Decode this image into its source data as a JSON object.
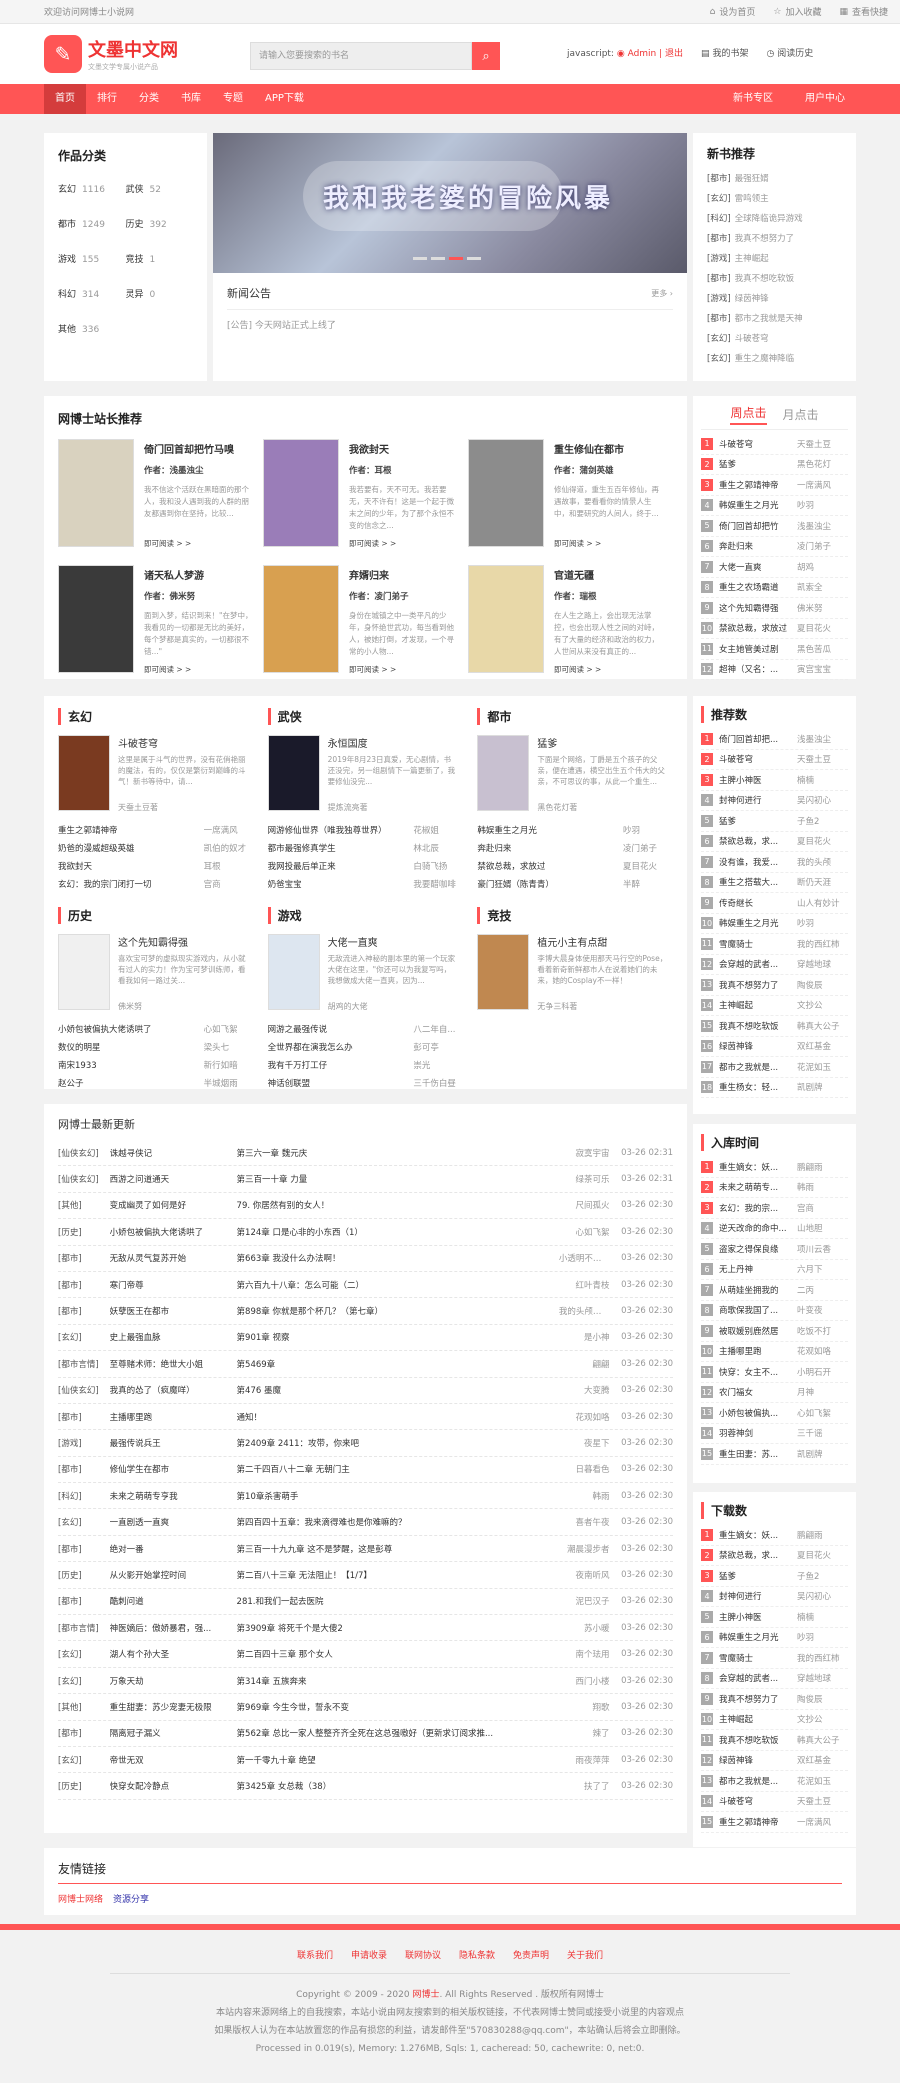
{
  "topbar": {
    "welcome": "欢迎访问网博士小说网",
    "set_home": "设为首页",
    "fav": "加入收藏",
    "hotkey": "查看快捷"
  },
  "logo": {
    "name": "文墨中文网",
    "slogan": "文墨文学专属小说产品"
  },
  "search": {
    "placeholder": "请输入您要搜索的书名"
  },
  "user": {
    "js": "javascript:",
    "admin": "Admin",
    "logout": "| 退出",
    "shelf": "我的书架",
    "history": "阅读历史"
  },
  "nav": {
    "items": [
      "首页",
      "排行",
      "分类",
      "书库",
      "专题",
      "APP下载"
    ],
    "right": [
      "新书专区",
      "用户中心"
    ]
  },
  "categories": {
    "title": "作品分类",
    "items": [
      {
        "n": "玄幻",
        "c": "1116"
      },
      {
        "n": "武侠",
        "c": "52"
      },
      {
        "n": "都市",
        "c": "1249"
      },
      {
        "n": "历史",
        "c": "392"
      },
      {
        "n": "游戏",
        "c": "155"
      },
      {
        "n": "竞技",
        "c": "1"
      },
      {
        "n": "科幻",
        "c": "314"
      },
      {
        "n": "灵异",
        "c": "0"
      },
      {
        "n": "其他",
        "c": "336"
      }
    ]
  },
  "banner": {
    "title": "我和我老婆的冒险风暴"
  },
  "notice": {
    "title": "新闻公告",
    "more": "更多 ›",
    "item": "[公告] 今天网站正式上线了"
  },
  "new_books": {
    "title": "新书推荐",
    "items": [
      {
        "t": "[都市]",
        "n": "最强狂婿"
      },
      {
        "t": "[玄幻]",
        "n": "雷鸣领主"
      },
      {
        "t": "[科幻]",
        "n": "全球降临诡异游戏"
      },
      {
        "t": "[都市]",
        "n": "我真不想努力了"
      },
      {
        "t": "[游戏]",
        "n": "主神崛起"
      },
      {
        "t": "[都市]",
        "n": "我真不想吃软饭"
      },
      {
        "t": "[游戏]",
        "n": "绿茵神锋"
      },
      {
        "t": "[都市]",
        "n": "都市之我就是天神"
      },
      {
        "t": "[玄幻]",
        "n": "斗破苍穹"
      },
      {
        "t": "[玄幻]",
        "n": "重生之魔神降临"
      }
    ]
  },
  "recommend": {
    "title": "网博士站长推荐",
    "books": [
      {
        "name": "倚门回首却把竹马嗅",
        "author": "作者：浅墨浊尘",
        "desc": "我不信这个活跃在黑暗面的那个人，我和没人遇到我的人群的朋友都遇到你在坚持，比较...",
        "more": "即可阅读 > >",
        "color": "#d9d2bf"
      },
      {
        "name": "我欲封天",
        "author": "作者：耳根",
        "desc": "我若要有，天不可无。我若要无，天不许有！这是一个起于微末之间的少年，为了那个永恒不变的信念之...",
        "more": "即可阅读 > >",
        "color": "#9a7db8"
      },
      {
        "name": "重生修仙在都市",
        "author": "作者：蒲剑英雄",
        "desc": "修仙得道，重生五百年修仙，再遇故事，要看看你的情景人生中，和要研究的人间人，终于...",
        "more": "即可阅读 > >",
        "color": "#8c8c8c"
      },
      {
        "name": "诸天私人梦游",
        "author": "作者：佛米努",
        "desc": "面到入梦，结识到来！\"在梦中，我看见的一切都是无比的美好，每个梦都是真实的，一切都很不错...\"",
        "more": "即可阅读 > >",
        "color": "#3a3a3a"
      },
      {
        "name": "弃婿归来",
        "author": "作者：凌门弟子",
        "desc": "身份在城镇之中一类平凡的少年，身怀绝世武功，每当看到他人，被她打倒，才发现，一个寻常的小人物...",
        "more": "即可阅读 > >",
        "color": "#d8a050"
      },
      {
        "name": "官道无疆",
        "author": "作者：瑞根",
        "desc": "在人生之路上，会出现无法掌控，也会出现人性之间的对峙，有了大量的经济和政治的权力，人世间从来没有真正的...",
        "more": "即可阅读 > >",
        "color": "#e8d8a8"
      }
    ]
  },
  "ranking_click": {
    "tab_active": "周点击",
    "tab2": "月点击",
    "items": [
      {
        "n": "斗破苍穹",
        "a": "天蚕土豆"
      },
      {
        "n": "猛爹",
        "a": "黑色花灯"
      },
      {
        "n": "重生之郭靖神帝",
        "a": "一席满风"
      },
      {
        "n": "韩娱重生之月光",
        "a": "吵羽"
      },
      {
        "n": "倚门回首却把竹",
        "a": "浅墨浊尘"
      },
      {
        "n": "奔赴归来",
        "a": "凌门弟子"
      },
      {
        "n": "大佬一直爽",
        "a": "胡鸡"
      },
      {
        "n": "重生之农场霸道",
        "a": "凯索全"
      },
      {
        "n": "这个先知霸得强",
        "a": "佛米努"
      },
      {
        "n": "禁欲总裁，求放过",
        "a": "夏目花火"
      },
      {
        "n": "女主她管美过剧",
        "a": "黑色苦瓜"
      },
      {
        "n": "超神（又名：...",
        "a": "寅宫宝宝"
      }
    ]
  },
  "sections": [
    {
      "title": "玄幻",
      "lead": {
        "name": "斗破苍穹",
        "desc": "这里是属于斗气的世界，没有花俏艳丽的魔法，有的，仅仅是繁衍到巅峰的斗气！新书等待中，请...",
        "author": "天蚕土豆著",
        "color": "#7a3a20"
      },
      "list": [
        [
          "重生之郭靖神帝",
          "一席满风"
        ],
        [
          "奶爸的漫威超级英雄",
          "凯伯的奴才"
        ],
        [
          "我欲封天",
          "耳根"
        ],
        [
          "玄幻：我的宗门闭打一切",
          "宫商"
        ]
      ]
    },
    {
      "title": "武侠",
      "lead": {
        "name": "永恒国度",
        "desc": "2019年8月23日真爱，无心剧情，书还没完，另一组剧情下一篇更新了，我要修仙没完...",
        "author": "提炼流亮著",
        "color": "#1a1a2a"
      },
      "list": [
        [
          "网游修仙世界（唯我独尊世界）",
          "花椒姐"
        ],
        [
          "都市最强修真学生",
          "林北辰"
        ],
        [
          "我网投最后单正来",
          "白骑飞扬"
        ],
        [
          "奶爸宝宝",
          "我要醋咖啡"
        ]
      ]
    },
    {
      "title": "都市",
      "lead": {
        "name": "猛爹",
        "desc": "下面是个网络，丁爵是五个孩子的父亲，便在遭遇，横空出生五个伟大的父亲，不可思议的事，从此一个重生...",
        "author": "黑色花灯著",
        "color": "#c8c0d0"
      },
      "list": [
        [
          "韩娱重生之月光",
          "吵羽"
        ],
        [
          "奔赴归来",
          "凌门弟子"
        ],
        [
          "禁欲总裁，求放过",
          "夏目花火"
        ],
        [
          "豪门狂婿（陈青青）",
          "半醉"
        ]
      ]
    },
    {
      "title": "历史",
      "lead": {
        "name": "这个先知霸得强",
        "desc": "喜欢宝可梦的虚拟现实游戏内，从小就有过人的实力！作为宝可梦训练师，看看我如何一路过关...",
        "author": "佛米努",
        "color": "#f0f0f0"
      },
      "list": [
        [
          "小娇包被偏执大佬诱哄了",
          "心如飞絮"
        ],
        [
          "数仪的明星",
          "梁头七"
        ],
        [
          "南宋1933",
          "新行如暗"
        ],
        [
          "赵公子",
          "半城烟雨"
        ]
      ]
    },
    {
      "title": "游戏",
      "lead": {
        "name": "大佬一直爽",
        "desc": "无敌流进入神秘的副本里的第一个玩家大佬在这里，\"你还可以为我复写吗，我想做成大佬一直爽，因为...",
        "author": "胡鸡的大佬",
        "color": "#dde6f0"
      },
      "list": [
        [
          "网游之最强传说",
          "八二年自..."
        ],
        [
          "全世界都在演我怎么办",
          "彭可亭"
        ],
        [
          "我有千万打工仔",
          "崇光"
        ],
        [
          "神话创联盟",
          "三千伤白昼"
        ]
      ]
    },
    {
      "title": "竞技",
      "lead": {
        "name": "植元小主有点甜",
        "desc": "李博大晨身体使用那天马行空的Pose，看着新奇新鲜都市人在说着她们的未来，她的Cosplay不一样！",
        "author": "无争三科著",
        "color": "#c08850"
      },
      "list": []
    }
  ],
  "ranking_rec": {
    "title": "推荐数",
    "items": [
      {
        "n": "倚门回首却把...",
        "a": "浅墨浊尘"
      },
      {
        "n": "斗破苍穹",
        "a": "天蚕土豆"
      },
      {
        "n": "主脾小神医",
        "a": "楠楠"
      },
      {
        "n": "封神何进行",
        "a": "吴闪初心"
      },
      {
        "n": "猛爹",
        "a": "子鱼2"
      },
      {
        "n": "禁欲总裁，求...",
        "a": "夏目花火"
      },
      {
        "n": "没有谁，我爱...",
        "a": "我的头颅"
      },
      {
        "n": "重生之搭载大...",
        "a": "断仍天涯"
      },
      {
        "n": "传奇继长",
        "a": "山人有妙计"
      },
      {
        "n": "韩娱重生之月光",
        "a": "吵羽"
      },
      {
        "n": "雪魔骑士",
        "a": "我的西红柿"
      },
      {
        "n": "会穿越的武者...",
        "a": "穿越地球"
      },
      {
        "n": "我真不想努力了",
        "a": "陶俊辰"
      },
      {
        "n": "主神崛起",
        "a": "文抄公"
      },
      {
        "n": "我真不想吃软饭",
        "a": "韩真大公子"
      },
      {
        "n": "绿茵神锋",
        "a": "双红基金"
      },
      {
        "n": "都市之我就是...",
        "a": "花泥如玉"
      },
      {
        "n": "重生杨女：轻...",
        "a": "凯剧牌"
      }
    ]
  },
  "ranking_time": {
    "title": "入库时间",
    "items": [
      {
        "n": "重生嫡女：妖...",
        "a": "鹏翩雨"
      },
      {
        "n": "未来之萌萌专...",
        "a": "韩雨"
      },
      {
        "n": "玄幻：我的宗...",
        "a": "宫商"
      },
      {
        "n": "逆天改命的命中...",
        "a": "山地胆"
      },
      {
        "n": "盗家之得保良缘",
        "a": "项川云香"
      },
      {
        "n": "无上丹神",
        "a": "六月下"
      },
      {
        "n": "从萌娃坐拥我的",
        "a": "二丙"
      },
      {
        "n": "商歌保我国了...",
        "a": "叶变夜"
      },
      {
        "n": "被取媛别鹿然居",
        "a": "吃饭不打"
      },
      {
        "n": "主播哪里跑",
        "a": "花观如咯"
      },
      {
        "n": "快穿：女主不...",
        "a": "小明石开"
      },
      {
        "n": "农门福女",
        "a": "月神"
      },
      {
        "n": "小娇包被偏执...",
        "a": "心如飞絮"
      },
      {
        "n": "羽蓉神剑",
        "a": "三千谣"
      },
      {
        "n": "重生田妻：苏...",
        "a": "凯剧牌"
      }
    ]
  },
  "ranking_down": {
    "title": "下载数",
    "items": [
      {
        "n": "重生嫡女：妖...",
        "a": "鹏翩雨"
      },
      {
        "n": "禁欲总裁，求...",
        "a": "夏目花火"
      },
      {
        "n": "猛爹",
        "a": "子鱼2"
      },
      {
        "n": "封神何进行",
        "a": "吴闪初心"
      },
      {
        "n": "主脾小神医",
        "a": "楠楠"
      },
      {
        "n": "韩娱重生之月光",
        "a": "吵羽"
      },
      {
        "n": "雪魔骑士",
        "a": "我的西红柿"
      },
      {
        "n": "会穿越的武者...",
        "a": "穿越地球"
      },
      {
        "n": "我真不想努力了",
        "a": "陶俊辰"
      },
      {
        "n": "主神崛起",
        "a": "文抄公"
      },
      {
        "n": "我真不想吃软饭",
        "a": "韩真大公子"
      },
      {
        "n": "绿茵神锋",
        "a": "双红基金"
      },
      {
        "n": "都市之我就是...",
        "a": "花泥如玉"
      },
      {
        "n": "斗破苍穹",
        "a": "天蚕土豆"
      },
      {
        "n": "重生之郭靖神帝",
        "a": "一席满风"
      }
    ]
  },
  "latest": {
    "title": "网博士最新更新",
    "rows": [
      [
        "[仙侠玄幻]",
        "诛越寻侠记",
        "第三六一章 魏元庆",
        "寂寞宇宙",
        "03-26 02:31"
      ],
      [
        "[仙侠玄幻]",
        "西游之问道通天",
        "第三百一十章 力量",
        "绿茶可乐",
        "03-26 02:31"
      ],
      [
        "[其他]",
        "变成幽灵了如何是好",
        "79. 你居然有别的女人！",
        "尺间孤火",
        "03-26 02:30"
      ],
      [
        "[历史]",
        "小娇包被偏执大佬诱哄了",
        "第124章 口是心非的小东西（1）",
        "心如飞絮",
        "03-26 02:30"
      ],
      [
        "[都市]",
        "无敌从灵气复苏开始",
        "第663章 我没什么办法啊！",
        "小透明不做事",
        "03-26 02:30"
      ],
      [
        "[都市]",
        "寒门帝尊",
        "第六百九十八章：怎么可能（二）",
        "红叶青枝",
        "03-26 02:30"
      ],
      [
        "[都市]",
        "妖孽医王在都市",
        "第898章 你就是那个杯几？（第七章）",
        "我的头颅很硬",
        "03-26 02:30"
      ],
      [
        "[玄幻]",
        "史上最强血脉",
        "第901章 视察",
        "是小神",
        "03-26 02:30"
      ],
      [
        "[都市言情]",
        "至尊赌术师：绝世大小姐",
        "第5469章",
        "翩翩",
        "03-26 02:30"
      ],
      [
        "[仙侠玄幻]",
        "我真的怂了（疯魔咩）",
        "第476 墨魔",
        "大变腾",
        "03-26 02:30"
      ],
      [
        "[都市]",
        "主播哪里跑",
        "通知！",
        "花观如咯",
        "03-26 02:30"
      ],
      [
        "[游戏]",
        "最强传说兵王",
        "第2409章 2411：攻带，你来吧",
        "夜星下",
        "03-26 02:30"
      ],
      [
        "[都市]",
        "修仙学生在都市",
        "第二千四百八十二章 无朝门主",
        "日暮看色",
        "03-26 02:30"
      ],
      [
        "[科幻]",
        "未来之萌萌专亨我",
        "第10章杀害萌手",
        "韩雨",
        "03-26 02:30"
      ],
      [
        "[玄幻]",
        "一直剧透一直爽",
        "第四百四十五章：我来滴得难也是你难嘛的？",
        "喜者午夜",
        "03-26 02:30"
      ],
      [
        "[都市]",
        "绝对一番",
        "第三百一十九九章 这不是梦醒，这是彭尊",
        "潮晨漫步者",
        "03-26 02:30"
      ],
      [
        "[历史]",
        "从火影开始掌控时间",
        "第二百八十三章 无法阻止！【1/7】",
        "夜南听风",
        "03-26 02:30"
      ],
      [
        "[都市]",
        "酷刺问道",
        "281.和我们一起去医院",
        "泥巴汉子",
        "03-26 02:30"
      ],
      [
        "[都市言情]",
        "神医嫡后：傲娇暴君，强...",
        "第3909章 将死千个是大傻2",
        "苏小暖",
        "03-26 02:30"
      ],
      [
        "[玄幻]",
        "湖人有个孙大圣",
        "第二百四十三章 那个女人",
        "南个珐用",
        "03-26 02:30"
      ],
      [
        "[玄幻]",
        "万象天劫",
        "第314章 五族奔来",
        "西门小楼",
        "03-26 02:30"
      ],
      [
        "[其他]",
        "重生甜妻：苏少宠妻无极限",
        "第969章 今生今世，誓永不变",
        "翔歌",
        "03-26 02:30"
      ],
      [
        "[都市]",
        "隔离冠子漏义",
        "第562章 总比一家人整整齐齐全死在这总强嗷好（更新求订阅求推...",
        "辣了",
        "03-26 02:30"
      ],
      [
        "[玄幻]",
        "帝世无双",
        "第一千零九十章 绝望",
        "雨夜萍萍",
        "03-26 02:30"
      ],
      [
        "[历史]",
        "快穿女配冷静点",
        "第3425章 女总裁（38）",
        "扶了了",
        "03-26 02:30"
      ]
    ]
  },
  "friends": {
    "title": "友情链接",
    "links": [
      "网博士网络",
      "资源分享"
    ]
  },
  "footer": {
    "links": [
      "联系我们",
      "申请收录",
      "联网协议",
      "隐私条款",
      "免责声明",
      "关于我们"
    ],
    "copyright": "Copyright © 2009 - 2020",
    "site": "网博士",
    "rights": ". All Rights Reserved . 版权所有网博士",
    "line2": "本站内容来源网络上的自我搜索，本站小说由网友搜索到的相关版权链接，不代表网博士赞同或接受小说里的内容观点",
    "line3": "如果版权人认为在本站放置您的作品有损您的利益，请发邮件至\"570830288@qq.com\"，本站确认后将会立即删除。",
    "line4": "Processed in 0.019(s), Memory: 1.276MB, Sqls: 1, cacheread: 50, cachewrite: 0, net:0."
  },
  "colors": {
    "accent": "#f55",
    "nav_active": "#d43c3c"
  }
}
